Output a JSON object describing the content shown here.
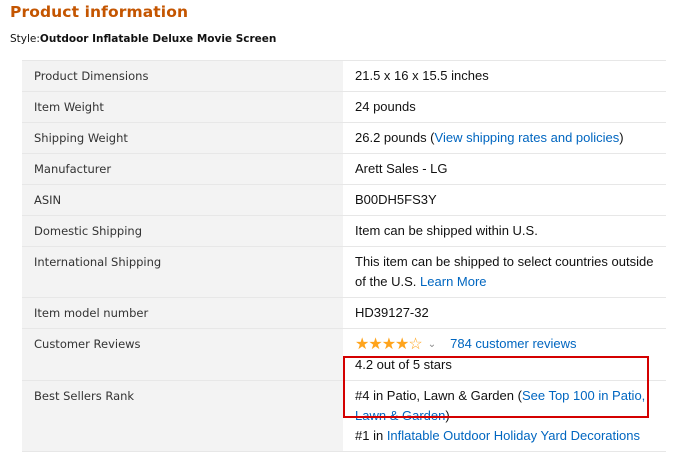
{
  "heading": "Product information",
  "style": {
    "prefix": "Style:",
    "value": "Outdoor Inflatable Deluxe Movie Screen"
  },
  "specs": {
    "dimensions": {
      "label": "Product Dimensions",
      "value": "21.5 x 16 x 15.5 inches"
    },
    "item_weight": {
      "label": "Item Weight",
      "value": "24 pounds"
    },
    "shipping_weight": {
      "label": "Shipping Weight",
      "value": "26.2 pounds (",
      "link": "View shipping rates and policies",
      "suffix": ")"
    },
    "manufacturer": {
      "label": "Manufacturer",
      "value": "Arett Sales - LG"
    },
    "asin": {
      "label": "ASIN",
      "value": "B00DH5FS3Y"
    },
    "domestic_shipping": {
      "label": "Domestic Shipping",
      "value": "Item can be shipped within U.S."
    },
    "international_shipping": {
      "label": "International Shipping",
      "value": "This item can be shipped to select countries outside of the U.S. ",
      "link": "Learn More"
    },
    "model_number": {
      "label": "Item model number",
      "value": "HD39127-32"
    },
    "customer_reviews": {
      "label": "Customer Reviews",
      "rating": 4.2,
      "stars_full": "★★★★",
      "stars_empty": "☆",
      "chevron": "⌄",
      "reviews_link": "784 customer reviews",
      "rating_text": "4.2 out of 5 stars"
    },
    "best_sellers": {
      "label": "Best Sellers Rank",
      "rank1_text": "#4 in Patio, Lawn & Garden (",
      "rank1_link": "See Top 100 in Patio, Lawn & Garden",
      "rank1_suffix": ")",
      "rank2_text": "#1 in ",
      "rank2_link": "Inflatable Outdoor Holiday Yard Decorations"
    }
  },
  "colors": {
    "heading": "#c45500",
    "link": "#0066c0",
    "star": "#ffa41c",
    "highlight": "#d40000",
    "label_bg": "#f3f3f3"
  }
}
